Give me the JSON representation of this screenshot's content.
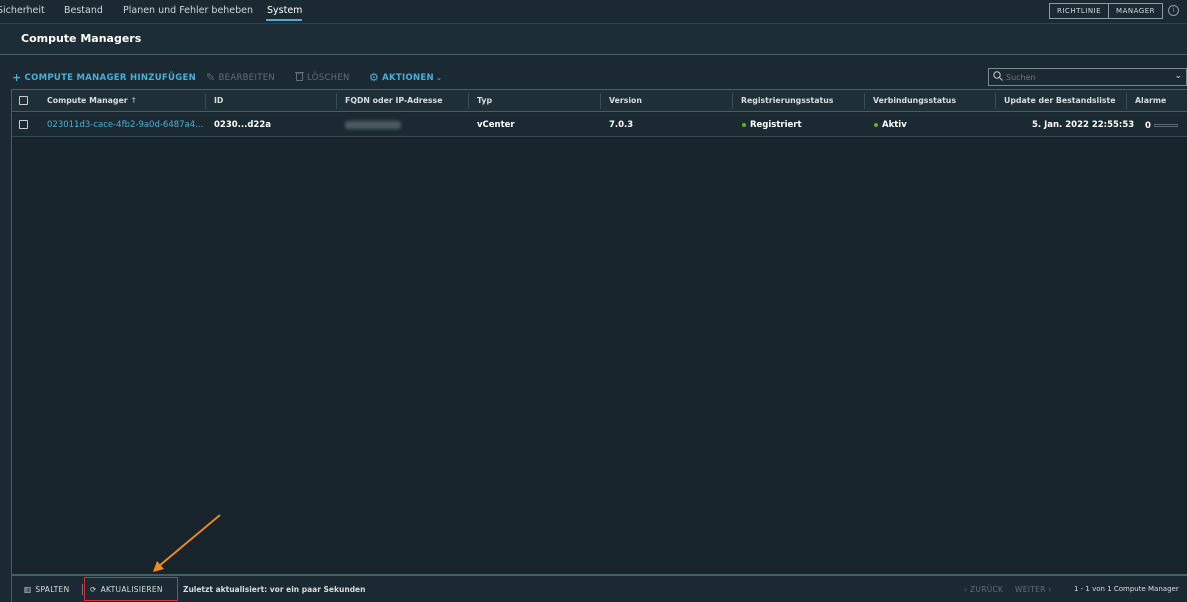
{
  "nav": {
    "tabs": [
      {
        "label": "Sicherheit"
      },
      {
        "label": "Bestand"
      },
      {
        "label": "Planen und Fehler beheben"
      },
      {
        "label": "System"
      }
    ],
    "active_tab": "System",
    "view_toggle": {
      "left": "RICHTLINIE",
      "right": "MANAGER"
    }
  },
  "page": {
    "title": "Compute Managers"
  },
  "toolbar": {
    "add": "COMPUTE MANAGER HINZUFÜGEN",
    "edit": "BEARBEITEN",
    "delete": "LÖSCHEN",
    "actions": "AKTIONEN",
    "search_placeholder": "Suchen"
  },
  "table": {
    "columns": [
      "Compute Manager",
      "ID",
      "FQDN oder IP-Adresse",
      "Typ",
      "Version",
      "Registrierungsstatus",
      "Verbindungsstatus",
      "Update der Bestandsliste",
      "Alarme"
    ],
    "sort_indicator": "↑",
    "rows": [
      {
        "name": "023011d3-cace-4fb2-9a0d-6487a4...",
        "id": "0230...d22a",
        "fqdn": "",
        "type": "vCenter",
        "version": "7.0.3",
        "registration": "Registriert",
        "connection": "Aktiv",
        "inventory_update": "5. Jan. 2022 22:55:53",
        "alarms": "0"
      }
    ]
  },
  "footer": {
    "columns": "SPALTEN",
    "refresh": "AKTUALISIEREN",
    "last_updated": "Zuletzt aktualisiert: vor ein paar Sekunden",
    "back": "ZURÜCK",
    "next": "WEITER",
    "count": "1 - 1 von 1 Compute Manager"
  },
  "colors": {
    "accent": "#49afd9",
    "status_ok": "#60b515",
    "highlight": "#e0283c",
    "annotation_arrow": "#f08c1e"
  }
}
